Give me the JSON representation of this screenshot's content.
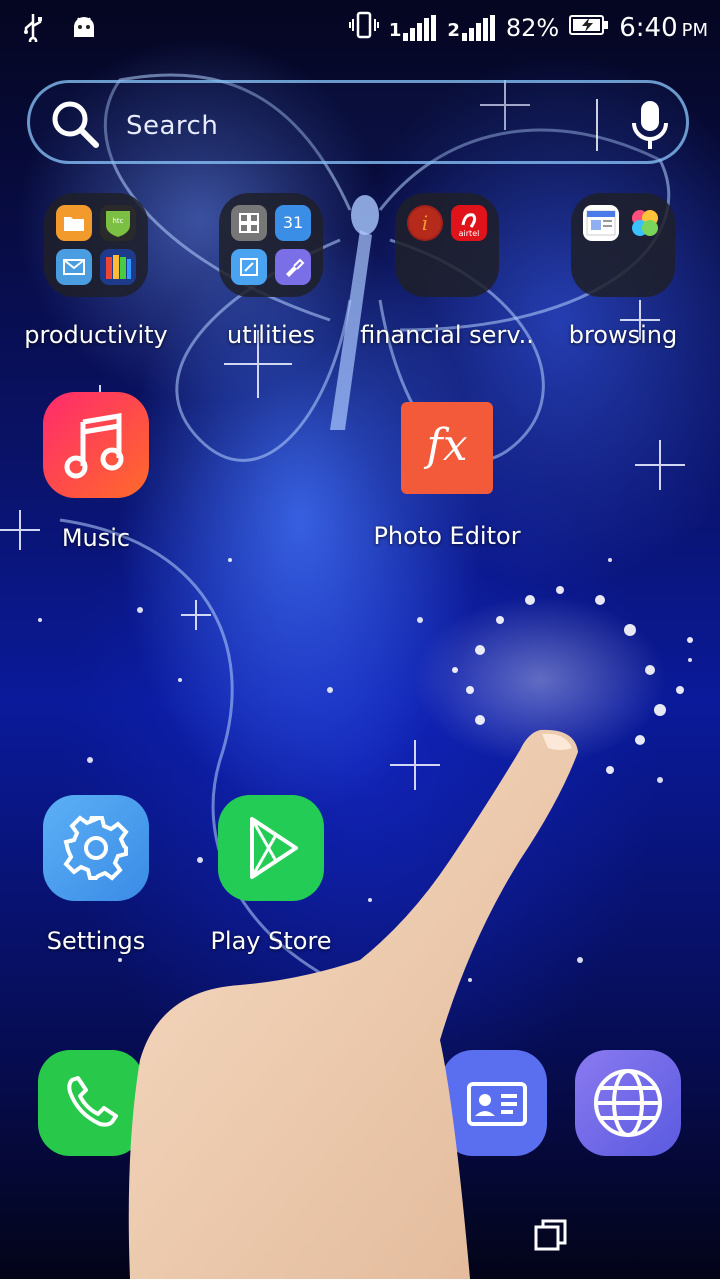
{
  "status_bar": {
    "battery_percent": "82%",
    "time": "6:40",
    "ampm": "PM",
    "sim1_label": "1",
    "sim2_label": "2",
    "icons": [
      "usb-icon",
      "android-icon",
      "vibrate-icon",
      "signal-icon",
      "battery-charging-icon"
    ]
  },
  "search": {
    "placeholder": "Search",
    "icons": [
      "search-icon",
      "mic-icon"
    ]
  },
  "folders": [
    {
      "label": "productivity",
      "apps": [
        "file-manager-icon",
        "htc-icon",
        "mail-icon",
        "docs-icon"
      ]
    },
    {
      "label": "utilities",
      "apps": [
        "calculator-icon",
        "calendar-icon",
        "screenshot-icon",
        "flashlight-icon"
      ]
    },
    {
      "label": "financial serv..",
      "apps": [
        "icici-icon",
        "airtel-icon"
      ],
      "badge": "airtel"
    },
    {
      "label": "browsing",
      "apps": [
        "google-news-icon",
        "photos-icon"
      ]
    }
  ],
  "calendar_day": "31",
  "apps": {
    "music": "Music",
    "photo_editor": "Photo Editor",
    "photo_editor_glyph": "fx",
    "settings": "Settings",
    "play_store": "Play Store"
  },
  "dock": [
    "phone-icon",
    "contacts-icon",
    "browser-icon"
  ],
  "nav": [
    "recents-icon"
  ],
  "colors": {
    "music_gradient": [
      "#ff2a6d",
      "#ff6a2a"
    ],
    "photo_editor": "#f25a3a",
    "settings": "#4da0f0",
    "play_store": "#22cc55",
    "phone": "#28c84a",
    "contacts": "#5a6ef0",
    "browser": "#6a6ae8"
  }
}
